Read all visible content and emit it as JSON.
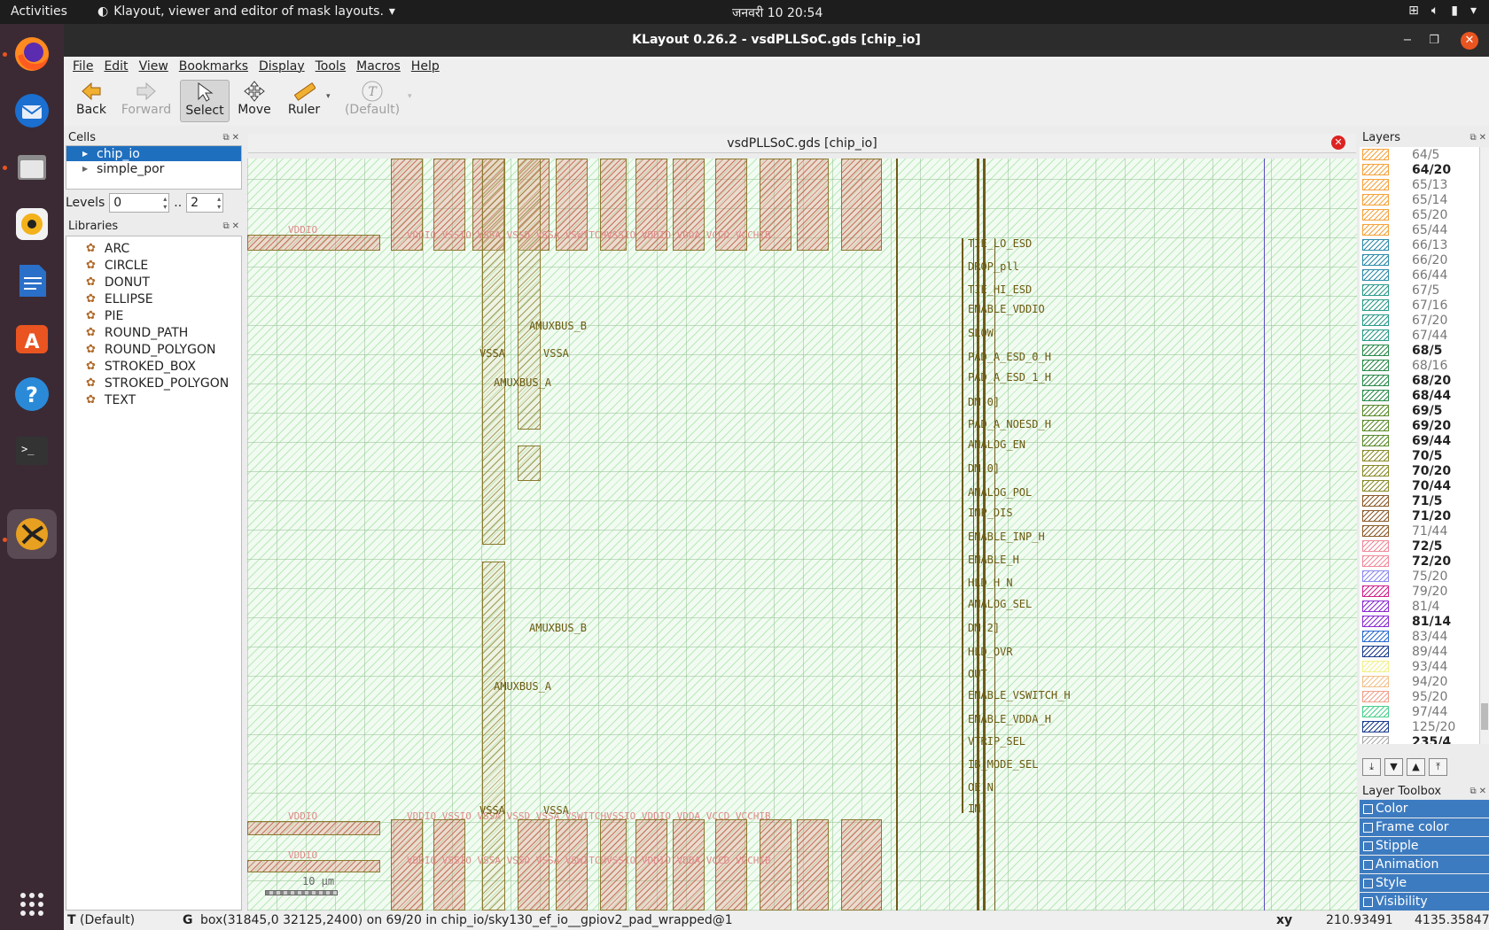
{
  "topbar": {
    "activities": "Activities",
    "app_title": "Klayout, viewer and editor of mask layouts.",
    "clock": "जनवरी 10  20:54"
  },
  "window": {
    "title": "KLayout 0.26.2 - vsdPLLSoC.gds [chip_io]"
  },
  "menu": [
    "File",
    "Edit",
    "View",
    "Bookmarks",
    "Display",
    "Tools",
    "Macros",
    "Help"
  ],
  "toolbar": {
    "back": "Back",
    "forward": "Forward",
    "select": "Select",
    "move": "Move",
    "ruler": "Ruler",
    "default": "(Default)"
  },
  "cells_panel": {
    "title": "Cells",
    "items": [
      "chip_io",
      "simple_por"
    ]
  },
  "levels": {
    "label": "Levels",
    "from": "0",
    "sep": "..",
    "to": "2"
  },
  "libraries": {
    "title": "Libraries",
    "items": [
      "ARC",
      "CIRCLE",
      "DONUT",
      "ELLIPSE",
      "PIE",
      "ROUND_PATH",
      "ROUND_POLYGON",
      "STROKED_BOX",
      "STROKED_POLYGON",
      "TEXT"
    ]
  },
  "canvas": {
    "tab_title": "vsdPLLSoC.gds [chip_io]",
    "labels_left": [
      "AMUXBUS_B",
      "VSSA",
      "VSSA",
      "AMUXBUS_A",
      "AMUXBUS_B",
      "AMUXBUS_A",
      "VSSA",
      "VSSA"
    ],
    "labels_right": [
      "TIE_LO_ESD",
      "DROP_pll",
      "TIE_HI_ESD",
      "ENABLE_VDDIO",
      "SLOW",
      "PAD_A_ESD_0_H",
      "PAD_A_ESD_1_H",
      "DM[0]",
      "PAD_A_NOESD_H",
      "ANALOG_EN",
      "DM[0]",
      "ANALOG_POL",
      "INP_DIS",
      "ENABLE_INP_H",
      "ENABLE_H",
      "HLD_H_N",
      "ANALOG_SEL",
      "DM[2]",
      "HLD_OVR",
      "OUT",
      "ENABLE_VSWITCH_H",
      "ENABLE_VDDA_H",
      "VTRIP_SEL",
      "IB_MODE_SEL",
      "OE_N",
      "IN"
    ],
    "pin_row_top": "VDDIO",
    "pin_row_text": "VDDIO VSSIO VSSA VSSD VSSA VSWITCHVSSIO VDDIO VDDA VCCD VCCHIB",
    "pin_row_bottom_1": "VDDIO",
    "pin_row_bottom_2": "VDDIO",
    "scale": "10 µm"
  },
  "layers_panel": {
    "title": "Layers",
    "items": [
      {
        "name": "64/5",
        "color": "#f6a23a",
        "bold": false
      },
      {
        "name": "64/20",
        "color": "#f6a23a",
        "bold": true
      },
      {
        "name": "65/13",
        "color": "#f6a23a",
        "bold": false
      },
      {
        "name": "65/14",
        "color": "#f6a23a",
        "bold": false
      },
      {
        "name": "65/20",
        "color": "#f6a23a",
        "bold": false
      },
      {
        "name": "65/44",
        "color": "#f6a23a",
        "bold": false
      },
      {
        "name": "66/13",
        "color": "#2a8aa8",
        "bold": false
      },
      {
        "name": "66/20",
        "color": "#2a8aa8",
        "bold": false
      },
      {
        "name": "66/44",
        "color": "#2a8aa8",
        "bold": false
      },
      {
        "name": "67/5",
        "color": "#2a9a8a",
        "bold": false
      },
      {
        "name": "67/16",
        "color": "#2a9a8a",
        "bold": false
      },
      {
        "name": "67/20",
        "color": "#2a9a8a",
        "bold": false
      },
      {
        "name": "67/44",
        "color": "#2a9a8a",
        "bold": false
      },
      {
        "name": "68/5",
        "color": "#2a8a4a",
        "bold": true
      },
      {
        "name": "68/16",
        "color": "#2a8a4a",
        "bold": false
      },
      {
        "name": "68/20",
        "color": "#2a8a4a",
        "bold": true
      },
      {
        "name": "68/44",
        "color": "#2a8a4a",
        "bold": true
      },
      {
        "name": "69/5",
        "color": "#5a8a2a",
        "bold": true
      },
      {
        "name": "69/20",
        "color": "#5a8a2a",
        "bold": true
      },
      {
        "name": "69/44",
        "color": "#5a8a2a",
        "bold": true
      },
      {
        "name": "70/5",
        "color": "#8a8a2a",
        "bold": true
      },
      {
        "name": "70/20",
        "color": "#8a8a2a",
        "bold": true
      },
      {
        "name": "70/44",
        "color": "#8a8a2a",
        "bold": true
      },
      {
        "name": "71/5",
        "color": "#8a5a2a",
        "bold": true
      },
      {
        "name": "71/20",
        "color": "#8a5a2a",
        "bold": true
      },
      {
        "name": "71/44",
        "color": "#8a5a2a",
        "bold": false
      },
      {
        "name": "72/5",
        "color": "#f08a9a",
        "bold": true
      },
      {
        "name": "72/20",
        "color": "#f08a9a",
        "bold": true
      },
      {
        "name": "75/20",
        "color": "#8a8af0",
        "bold": false
      },
      {
        "name": "79/20",
        "color": "#d0208a",
        "bold": false
      },
      {
        "name": "81/4",
        "color": "#8a2ad0",
        "bold": false
      },
      {
        "name": "81/14",
        "color": "#8a2ad0",
        "bold": true
      },
      {
        "name": "83/44",
        "color": "#2a6ad0",
        "bold": false
      },
      {
        "name": "89/44",
        "color": "#1a3a8a",
        "bold": false
      },
      {
        "name": "93/44",
        "color": "#f0f08a",
        "bold": false
      },
      {
        "name": "94/20",
        "color": "#f0c08a",
        "bold": false
      },
      {
        "name": "95/20",
        "color": "#f0a08a",
        "bold": false
      },
      {
        "name": "97/44",
        "color": "#4ad08a",
        "bold": false
      },
      {
        "name": "125/20",
        "color": "#1a3a8a",
        "bold": false
      },
      {
        "name": "235/4",
        "color": "#aaaaaa",
        "bold": true
      }
    ]
  },
  "layer_toolbox": {
    "title": "Layer Toolbox",
    "items": [
      "Color",
      "Frame color",
      "Stipple",
      "Animation",
      "Style",
      "Visibility"
    ]
  },
  "status": {
    "mode": "T",
    "mode_text": "(Default)",
    "g": "G",
    "info": "box(31845,0 32125,2400) on 69/20 in chip_io/sky130_ef_io__gpiov2_pad_wrapped@1",
    "xy_label": "xy",
    "x": "210.93491",
    "y": "4135.35847"
  }
}
